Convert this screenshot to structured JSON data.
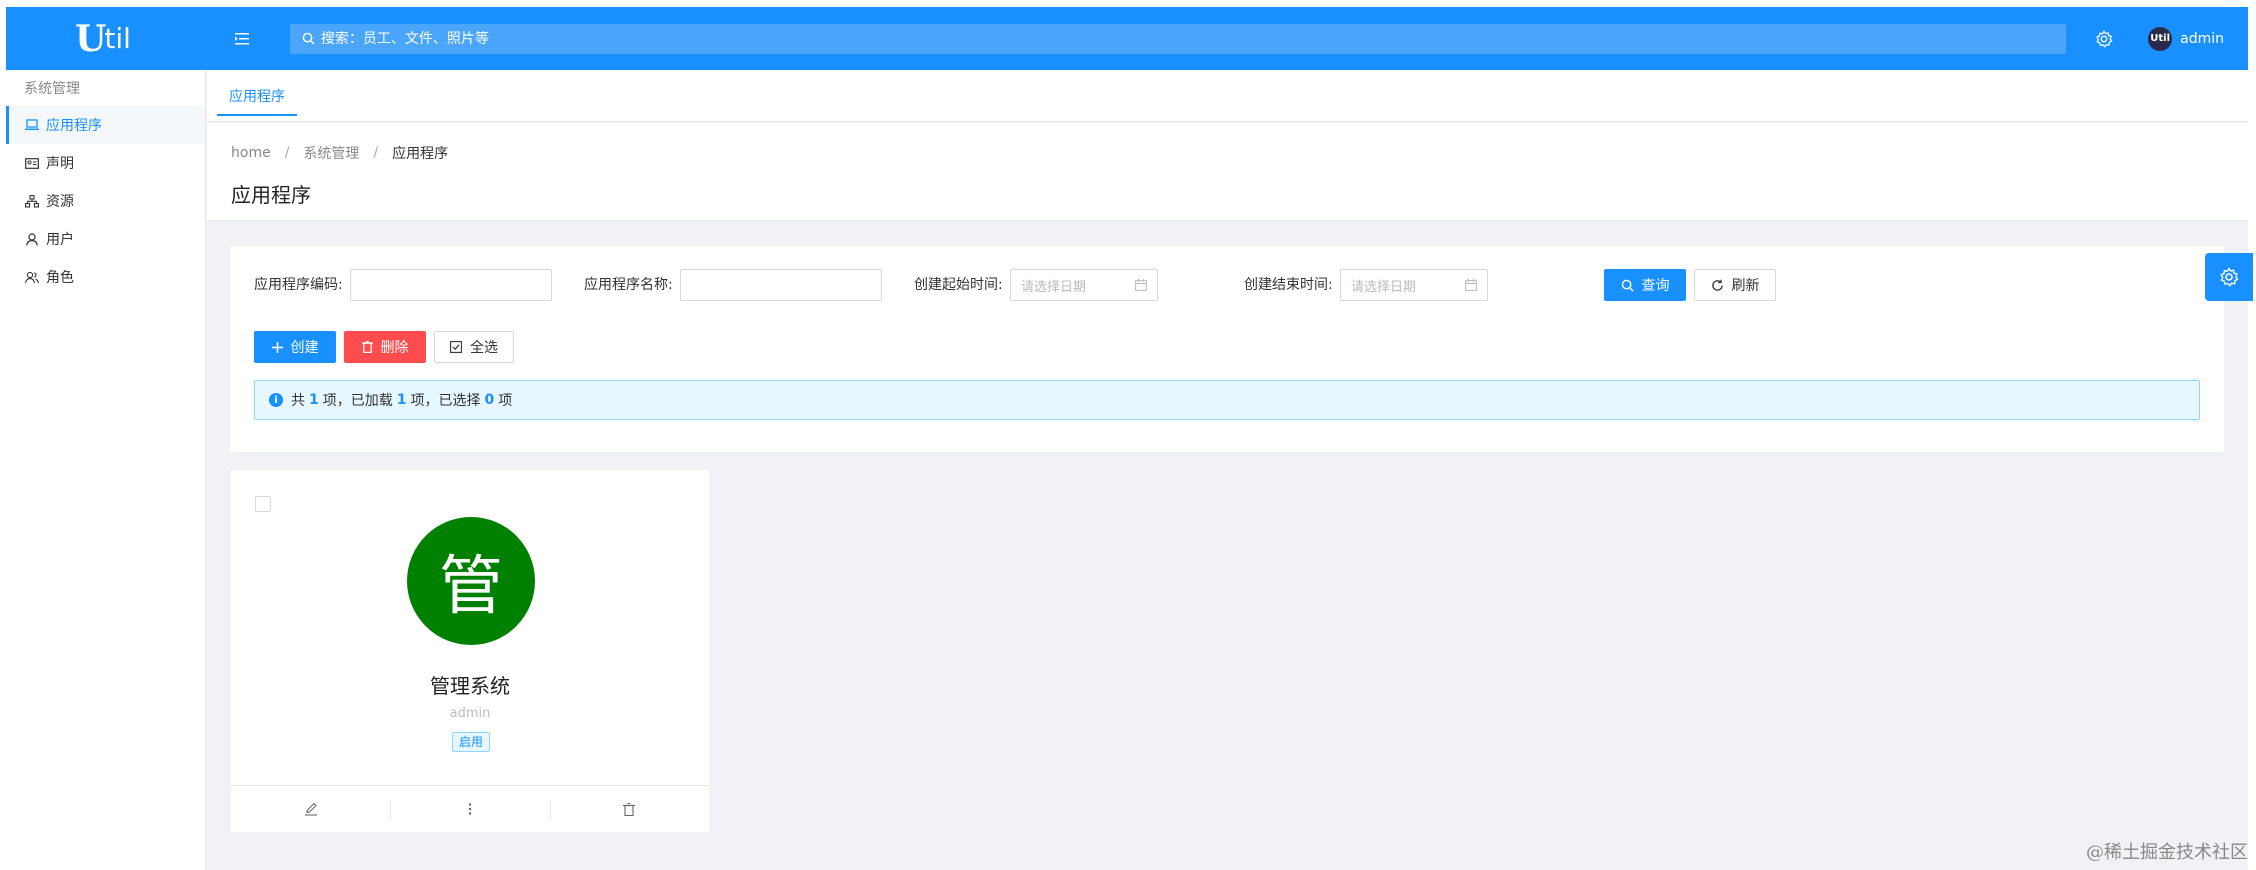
{
  "header": {
    "logo_main": "U",
    "logo_sub": "til",
    "search_placeholder": "搜索：员工、文件、照片等",
    "avatar_text": "Util",
    "username": "admin"
  },
  "sidebar": {
    "group": "系统管理",
    "items": [
      {
        "label": "应用程序",
        "icon": "laptop-icon",
        "active": true
      },
      {
        "label": "声明",
        "icon": "id-card-icon"
      },
      {
        "label": "资源",
        "icon": "sitemap-icon"
      },
      {
        "label": "用户",
        "icon": "user-icon"
      },
      {
        "label": "角色",
        "icon": "team-icon"
      }
    ]
  },
  "tabs": [
    {
      "label": "应用程序"
    }
  ],
  "breadcrumb": [
    "home",
    "系统管理",
    "应用程序"
  ],
  "page_title": "应用程序",
  "filters": {
    "code_label": "应用程序编码:",
    "name_label": "应用程序名称:",
    "start_label": "创建起始时间:",
    "end_label": "创建结束时间:",
    "date_placeholder": "请选择日期",
    "query_label": "查询",
    "refresh_label": "刷新"
  },
  "actions": {
    "create_label": "创建",
    "delete_label": "删除",
    "select_all_label": "全选"
  },
  "summary": {
    "prefix": "共",
    "total": "1",
    "items_unit": "项，已加载",
    "loaded": "1",
    "loaded_unit": "项，已选择",
    "selected": "0",
    "selected_unit": "项"
  },
  "app_card": {
    "avatar_char": "管",
    "avatar_color": "#008000",
    "name": "管理系统",
    "owner": "admin",
    "status": "启用"
  },
  "colors": {
    "primary": "#1890ff",
    "danger": "#ff4d4f"
  },
  "watermark": "@稀土掘金技术社区"
}
